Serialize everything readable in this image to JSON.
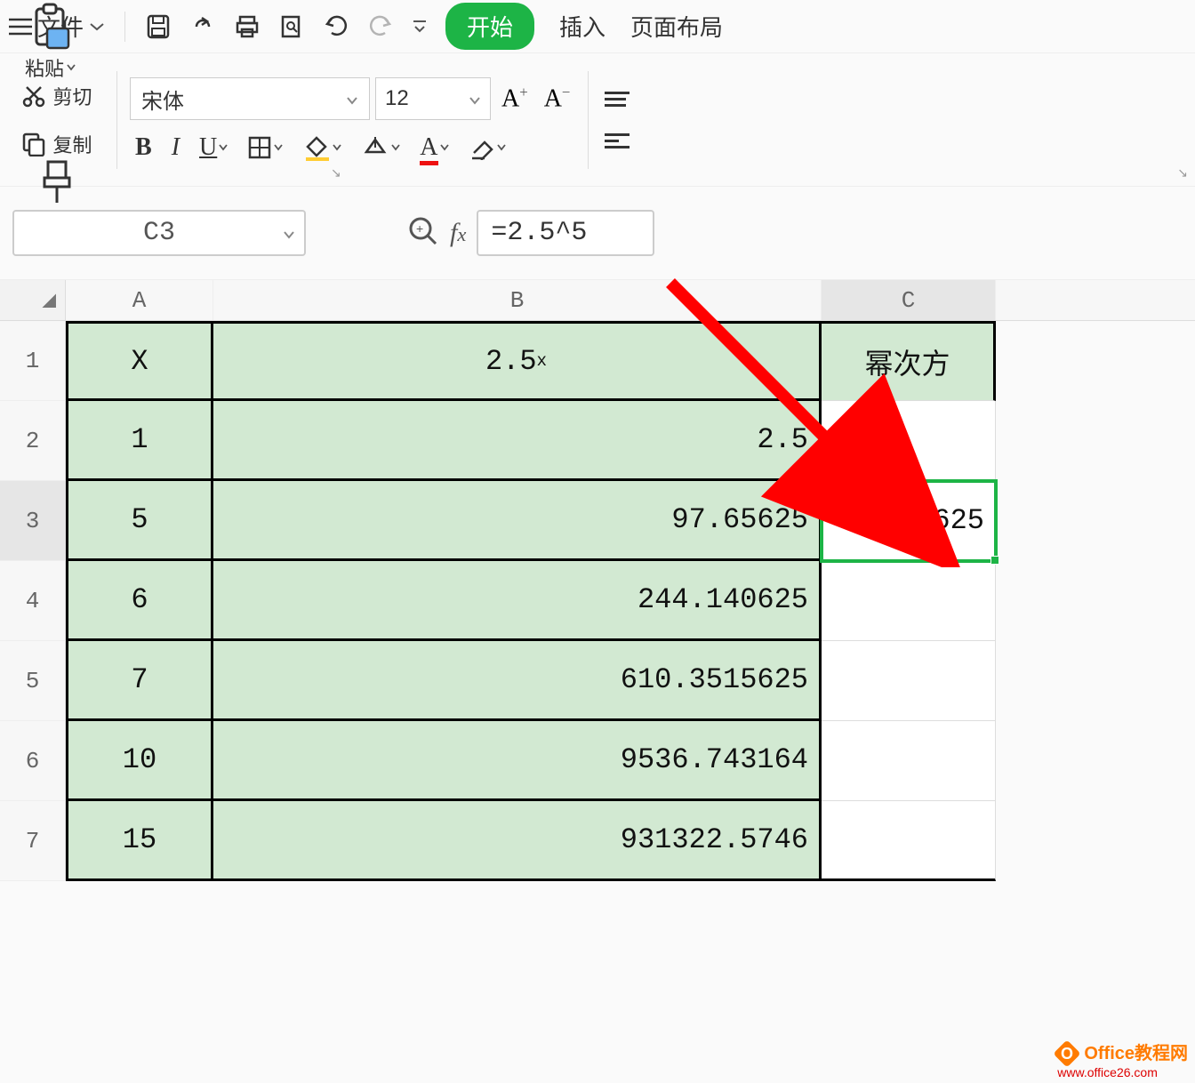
{
  "menu": {
    "file": "文件",
    "tab_begin": "开始",
    "tab_insert": "插入",
    "tab_layout": "页面布局"
  },
  "ribbon": {
    "paste": "粘贴",
    "cut": "剪切",
    "copy": "复制",
    "format_brush": "格式刷",
    "font_name": "宋体",
    "font_size": "12"
  },
  "formula_bar": {
    "cell_ref": "C3",
    "formula": "=2.5^5"
  },
  "columns": {
    "A": "A",
    "B": "B",
    "C": "C"
  },
  "rows": {
    "r1": "1",
    "r2": "2",
    "r3": "3",
    "r4": "4",
    "r5": "5",
    "r6": "6",
    "r7": "7"
  },
  "table": {
    "header": {
      "A": "X",
      "B": "2.5",
      "B_sup": "x",
      "C": "幂次方"
    },
    "data": [
      {
        "A": "1",
        "B": "2.5",
        "C": ""
      },
      {
        "A": "5",
        "B": "97.65625",
        "C": "97.65625"
      },
      {
        "A": "6",
        "B": "244.140625",
        "C": ""
      },
      {
        "A": "7",
        "B": "610.3515625",
        "C": ""
      },
      {
        "A": "10",
        "B": "9536.743164",
        "C": ""
      },
      {
        "A": "15",
        "B": "931322.5746",
        "C": ""
      }
    ]
  },
  "watermark": {
    "title": "Office教程网",
    "url": "www.office26.com",
    "badge": "O"
  }
}
